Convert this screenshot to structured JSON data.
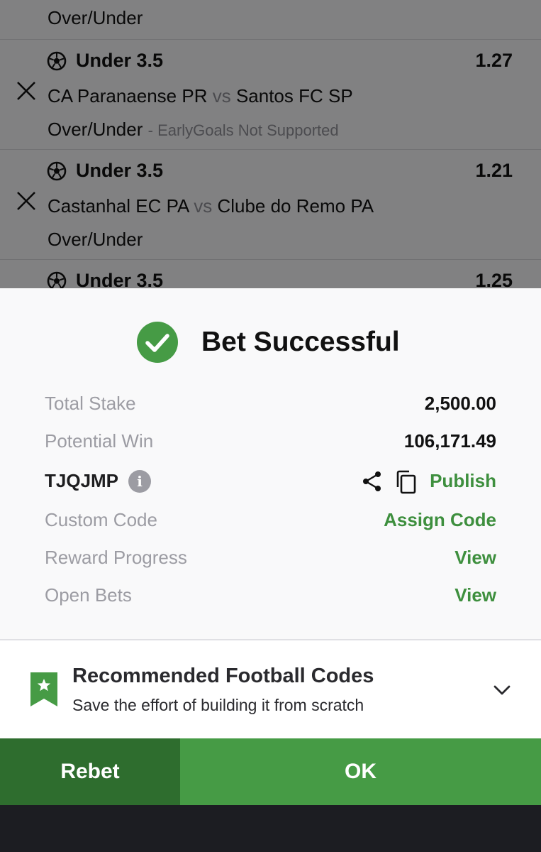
{
  "betslip": {
    "previous_market": "Over/Under",
    "selections": [
      {
        "pick": "Under 3.5",
        "odds": "1.27",
        "home": "CA Paranaense PR",
        "vs": "vs",
        "away": "Santos FC SP",
        "market": "Over/Under",
        "note": "- EarlyGoals Not Supported"
      },
      {
        "pick": "Under 3.5",
        "odds": "1.21",
        "home": "Castanhal EC PA",
        "vs": "vs",
        "away": "Clube do Remo PA",
        "market": "Over/Under",
        "note": ""
      },
      {
        "pick": "Under 3.5",
        "odds": "1.25",
        "home": "",
        "vs": "",
        "away": "",
        "market": "",
        "note": ""
      }
    ]
  },
  "success": {
    "title": "Bet Successful",
    "rows": {
      "total_stake": {
        "label": "Total Stake",
        "value": "2,500.00"
      },
      "potential_win": {
        "label": "Potential Win",
        "value": "106,171.49"
      },
      "booking_code": {
        "label": "TJQJMP",
        "action": "Publish"
      },
      "custom_code": {
        "label": "Custom Code",
        "action": "Assign Code"
      },
      "reward_progress": {
        "label": "Reward Progress",
        "action": "View"
      },
      "open_bets": {
        "label": "Open Bets",
        "action": "View"
      }
    }
  },
  "recommendation": {
    "title": "Recommended Football Codes",
    "subtitle": "Save the effort of building it from scratch"
  },
  "buttons": {
    "rebet": "Rebet",
    "ok": "OK"
  },
  "icons": {
    "success": "check-circle-icon",
    "remove": "close-icon",
    "sport": "soccer-ball-icon",
    "info": "info-icon",
    "share": "share-icon",
    "copy": "copy-icon",
    "bookmark": "bookmark-star-icon",
    "expand": "chevron-down-icon"
  },
  "colors": {
    "brand_green": "#469b45",
    "brand_green_dark": "#2e6d2e",
    "link_green": "#3e8f3e",
    "muted_text": "#9c9ca3"
  }
}
